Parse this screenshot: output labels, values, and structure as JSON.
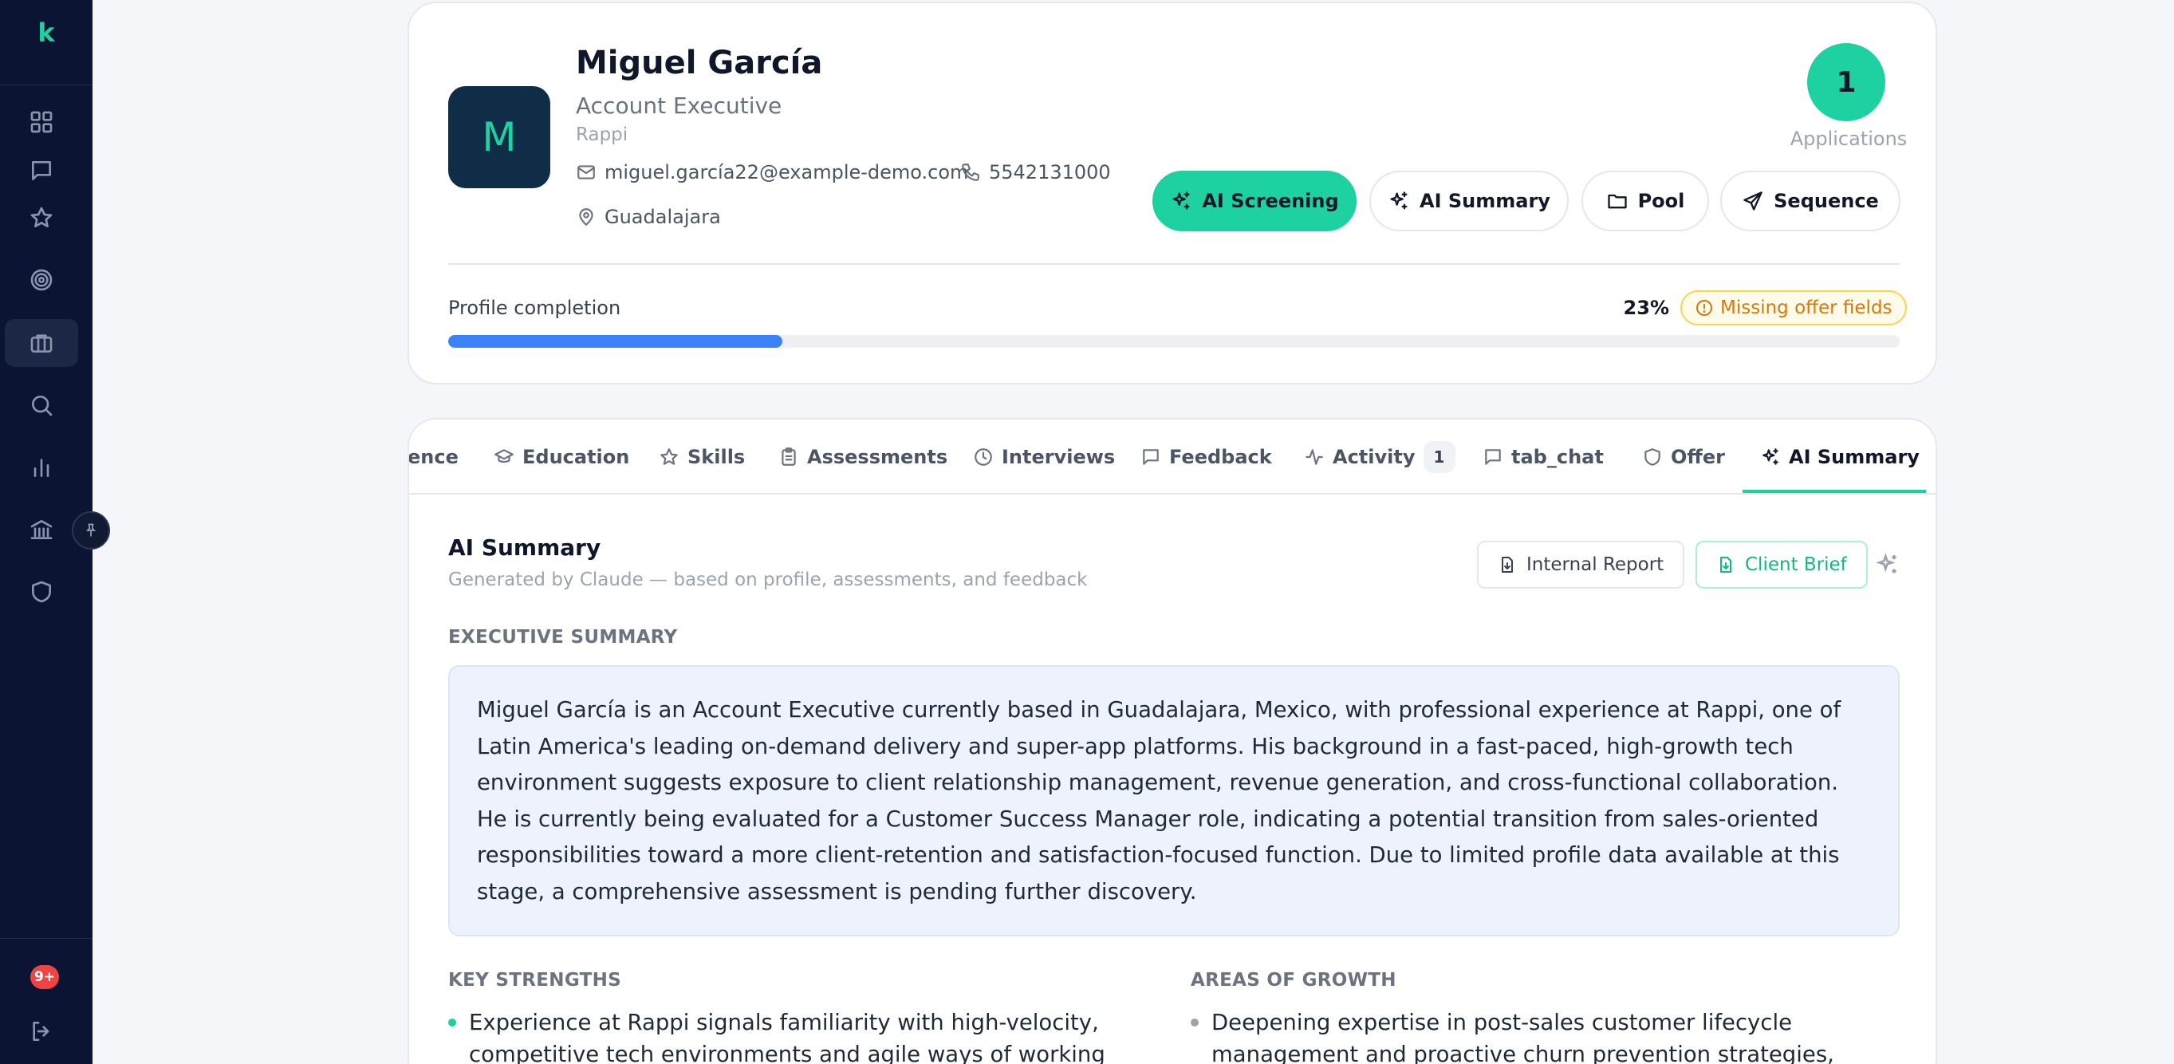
{
  "sidebar": {
    "logo": "k",
    "notification_badge": "9+",
    "items": [
      {
        "icon": "grid-icon"
      },
      {
        "icon": "chat-icon"
      },
      {
        "icon": "star-icon"
      },
      {
        "icon": "target-icon"
      },
      {
        "icon": "briefcase-icon",
        "active": true
      },
      {
        "icon": "search-icon"
      },
      {
        "icon": "bar-chart-icon"
      },
      {
        "icon": "bank-icon"
      },
      {
        "icon": "shield-icon"
      }
    ]
  },
  "candidate": {
    "initial": "M",
    "name": "Miguel García",
    "role": "Account Executive",
    "company": "Rappi",
    "email": "miguel.garcía22@example-demo.com",
    "phone": "5542131000",
    "location": "Guadalajara",
    "applications_count": "1",
    "applications_label": "Applications"
  },
  "actions": {
    "ai_screening": "AI Screening",
    "ai_summary": "AI Summary",
    "pool": "Pool",
    "sequence": "Sequence"
  },
  "profile_completion": {
    "label": "Profile completion",
    "percent_text": "23%",
    "percent": 23,
    "badge": "Missing offer fields"
  },
  "tabs": [
    {
      "label": "ence"
    },
    {
      "label": "Education"
    },
    {
      "label": "Skills"
    },
    {
      "label": "Assessments"
    },
    {
      "label": "Interviews"
    },
    {
      "label": "Feedback"
    },
    {
      "label": "Activity",
      "count": "1"
    },
    {
      "label": "tab_chat"
    },
    {
      "label": "Offer"
    },
    {
      "label": "AI Summary",
      "active": true
    }
  ],
  "ai_summary": {
    "title": "AI Summary",
    "subtitle": "Generated by Claude — based on profile, assessments, and feedback",
    "internal_report": "Internal Report",
    "client_brief": "Client Brief",
    "executive_summary_label": "EXECUTIVE SUMMARY",
    "executive_summary": "Miguel García is an Account Executive currently based in Guadalajara, Mexico, with professional experience at Rappi, one of Latin America's leading on-demand delivery and super-app platforms. His background in a fast-paced, high-growth tech environment suggests exposure to client relationship management, revenue generation, and cross-functional collaboration. He is currently being evaluated for a Customer Success Manager role, indicating a potential transition from sales-oriented responsibilities toward a more client-retention and satisfaction-focused function. Due to limited profile data available at this stage, a comprehensive assessment is pending further discovery.",
    "key_strengths_label": "KEY STRENGTHS",
    "key_strengths": [
      "Experience at Rappi signals familiarity with high-velocity, competitive tech environments and agile ways of working"
    ],
    "areas_of_growth_label": "AREAS OF GROWTH",
    "areas_of_growth": [
      "Deepening expertise in post-sales customer lifecycle management and proactive churn prevention strategies, which"
    ]
  },
  "colors": {
    "accent": "#1dd1a1",
    "sidebar_bg": "#0b1533",
    "progress": "#3b82f6",
    "warning": "#d97706"
  }
}
